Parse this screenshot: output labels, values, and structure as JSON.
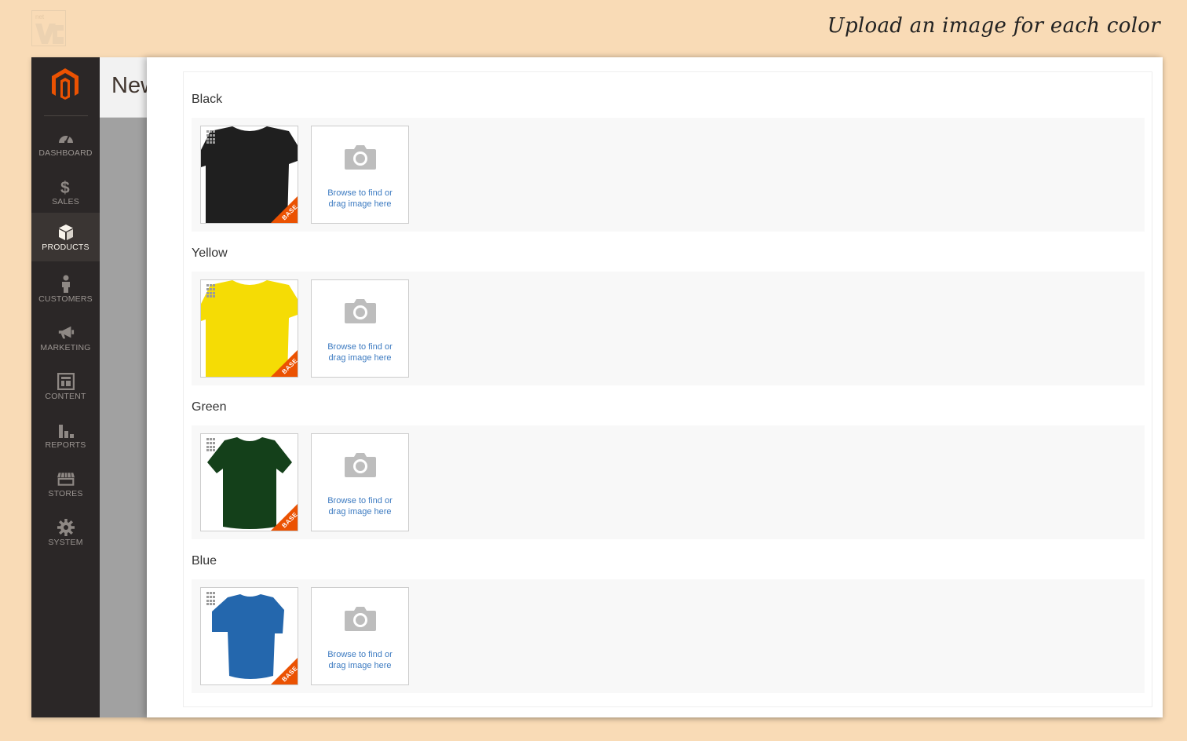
{
  "header": {
    "caption": "Upload an image for each color"
  },
  "page": {
    "title": "New"
  },
  "sidebar": {
    "items": [
      {
        "label": "DASHBOARD",
        "icon": "dashboard-icon",
        "active": false
      },
      {
        "label": "SALES",
        "icon": "dollar-icon",
        "active": false
      },
      {
        "label": "PRODUCTS",
        "icon": "box-icon",
        "active": true
      },
      {
        "label": "CUSTOMERS",
        "icon": "person-icon",
        "active": false
      },
      {
        "label": "MARKETING",
        "icon": "megaphone-icon",
        "active": false
      },
      {
        "label": "CONTENT",
        "icon": "layout-icon",
        "active": false
      },
      {
        "label": "REPORTS",
        "icon": "bar-chart-icon",
        "active": false
      },
      {
        "label": "STORES",
        "icon": "storefront-icon",
        "active": false
      },
      {
        "label": "SYSTEM",
        "icon": "gear-icon",
        "active": false
      }
    ]
  },
  "colors": {
    "accent": "#eb5202",
    "sidebar_bg": "#2b2727",
    "link": "#3d7bc1",
    "page_bg": "#f9dbb6"
  },
  "color_groups": [
    {
      "label": "Black",
      "shirt_color": "#1f1f1f",
      "badge": "BASE"
    },
    {
      "label": "Yellow",
      "shirt_color": "#f5dc05",
      "badge": "BASE"
    },
    {
      "label": "Green",
      "shirt_color": "#14401a",
      "badge": "BASE"
    },
    {
      "label": "Blue",
      "shirt_color": "#2467ad",
      "badge": "BASE"
    }
  ],
  "uploader": {
    "line1": "Browse to find or",
    "line2": "drag image here"
  }
}
